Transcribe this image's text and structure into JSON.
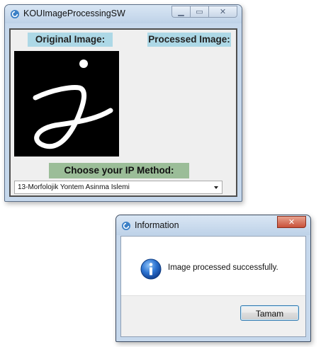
{
  "main_window": {
    "title": "KOUImageProcessingSW",
    "original_label": "Original Image:",
    "processed_label": "Processed Image:",
    "choose_label": "Choose your IP Method:",
    "method_selected": "13-Morfolojik Yontem Asinma Islemi",
    "controls": {
      "minimize_icon": "minimize-icon",
      "maximize_icon": "maximize-icon",
      "close_icon": "close-icon"
    }
  },
  "dialog": {
    "title": "Information",
    "message": "Image processed successfully.",
    "ok_label": "Tamam",
    "icon": "info-icon"
  },
  "colors": {
    "label_blue": "#add8e6",
    "label_green": "#9bbd98",
    "client_bg": "#efefef",
    "close_red": "#c9513a"
  }
}
